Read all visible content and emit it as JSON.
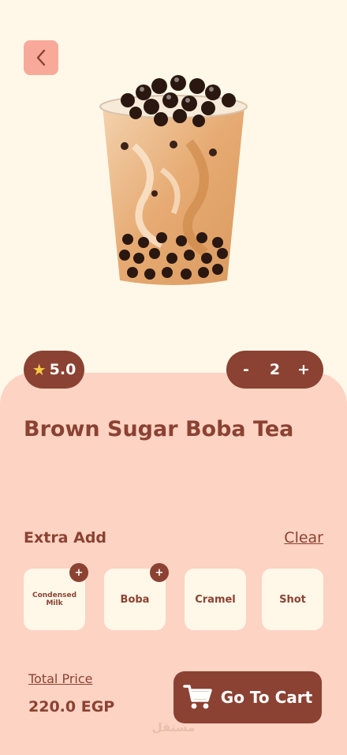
{
  "product": {
    "title": "Brown Sugar Boba Tea",
    "rating": "5.0",
    "quantity": "2",
    "decrement_label": "-",
    "increment_label": "+"
  },
  "extras": {
    "heading": "Extra Add",
    "clear_label": "Clear",
    "items": [
      {
        "label": "Condensed Milk",
        "badge": "+"
      },
      {
        "label": "Boba",
        "badge": "+"
      },
      {
        "label": "Cramel"
      },
      {
        "label": "Shot"
      }
    ]
  },
  "checkout": {
    "total_label": "Total Price",
    "total_value": "220.0 EGP",
    "cart_button_label": "Go To Cart"
  },
  "icons": {
    "back": "chevron-left-icon",
    "rating": "star-icon",
    "cart": "cart-icon"
  },
  "colors": {
    "background": "#fff8e8",
    "panel": "#fdd3c3",
    "accent": "#8b4232",
    "back_button": "#f8a99a",
    "star": "#f7c845"
  },
  "watermark": "مستقل"
}
